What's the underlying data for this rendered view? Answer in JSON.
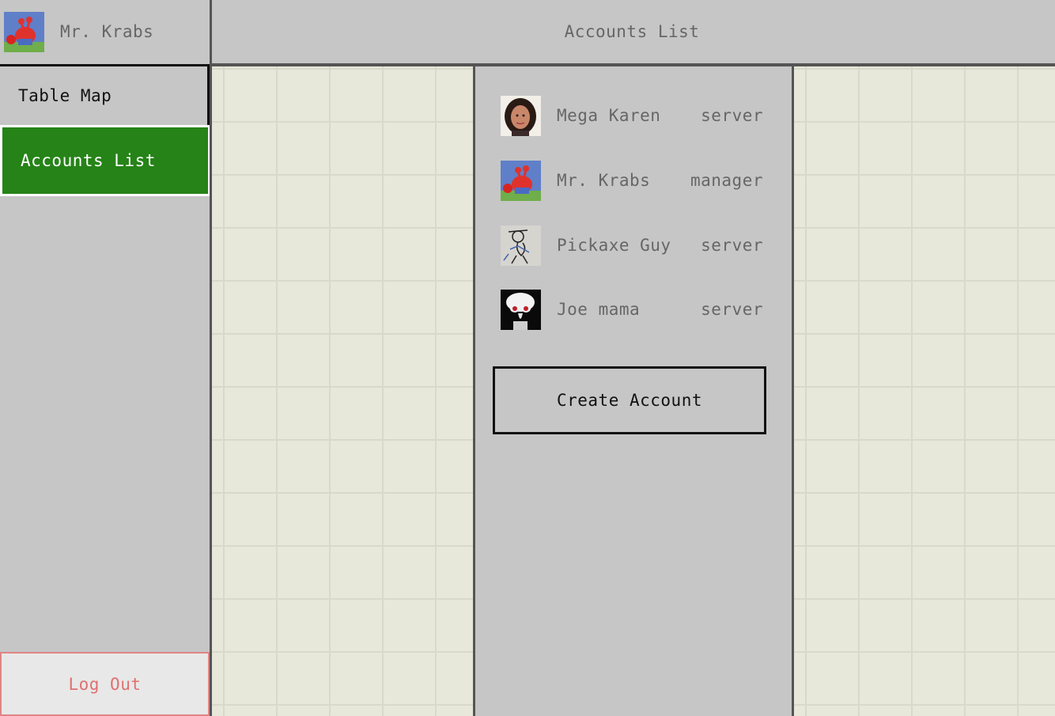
{
  "header": {
    "user_name": "Mr. Krabs",
    "page_title": "Accounts List"
  },
  "sidebar": {
    "items": [
      {
        "label": "Table Map",
        "active": false
      },
      {
        "label": "Accounts List",
        "active": true
      }
    ],
    "logout_label": "Log Out"
  },
  "accounts": [
    {
      "name": "Mega Karen",
      "role": "server",
      "avatar": "woman-portrait-avatar"
    },
    {
      "name": "Mr. Krabs",
      "role": "manager",
      "avatar": "crab-avatar"
    },
    {
      "name": "Pickaxe Guy",
      "role": "server",
      "avatar": "sketch-avatar"
    },
    {
      "name": "Joe mama",
      "role": "server",
      "avatar": "squid-avatar"
    }
  ],
  "create_account_label": "Create Account",
  "colors": {
    "active_nav": "#268318",
    "logout_text": "#e07070",
    "panel_bg": "#c6c6c6",
    "tile_bg": "#e7e7da"
  }
}
